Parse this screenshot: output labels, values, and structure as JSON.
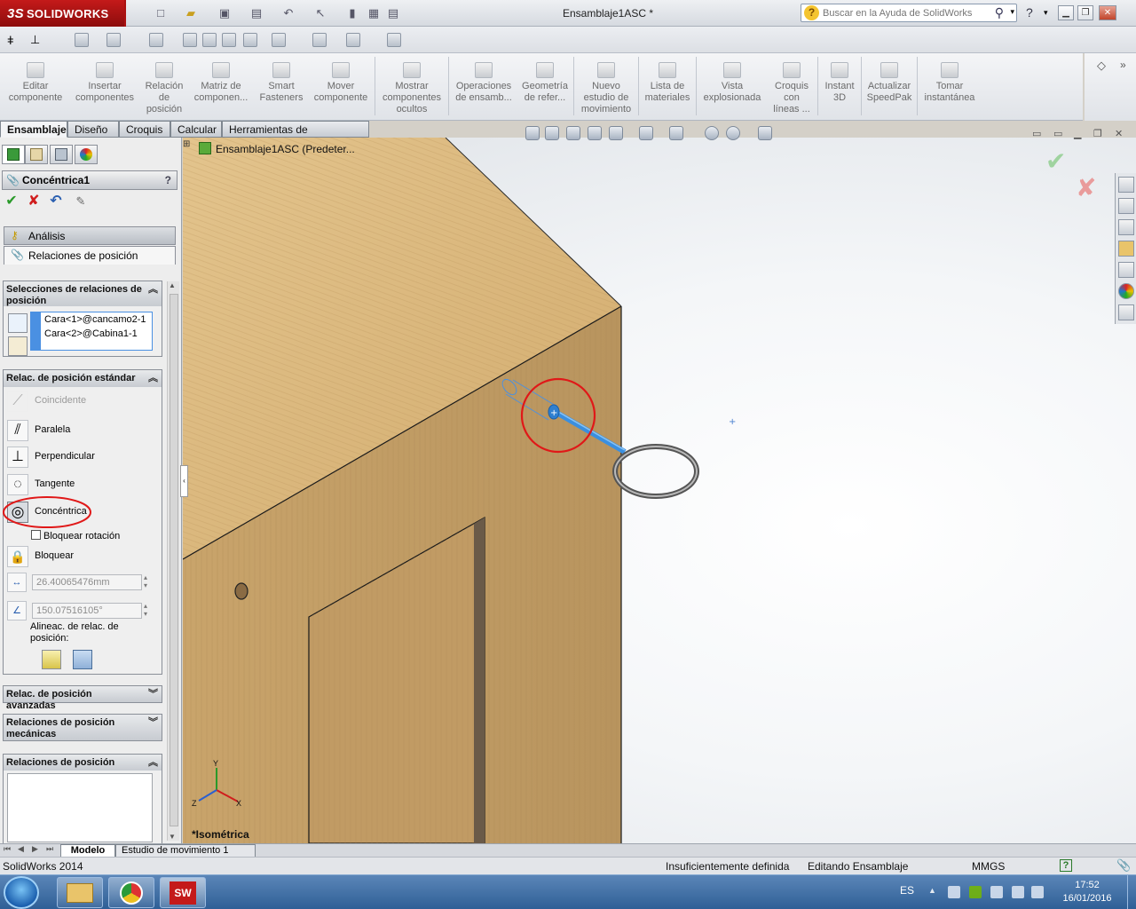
{
  "app": {
    "brand": "SOLIDWORKS",
    "brand_prefix": "3S",
    "window_title": "Ensamblaje1ASC *",
    "help_search_placeholder": "Buscar en la Ayuda de SolidWorks",
    "help_menu": "?"
  },
  "commands": [
    {
      "label": "Editar\ncomponente"
    },
    {
      "label": "Insertar\ncomponentes"
    },
    {
      "label": "Relación\nde\nposición"
    },
    {
      "label": "Matriz de\ncomponen..."
    },
    {
      "label": "Smart\nFasteners"
    },
    {
      "label": "Mover\ncomponente"
    },
    {
      "label": "Mostrar\ncomponentes\nocultos"
    },
    {
      "label": "Operaciones\nde ensamb..."
    },
    {
      "label": "Geometría\nde refer..."
    },
    {
      "label": "Nuevo\nestudio de\nmovimiento"
    },
    {
      "label": "Lista de\nmateriales"
    },
    {
      "label": "Vista\nexplosionada"
    },
    {
      "label": "Croquis\ncon\nlíneas ..."
    },
    {
      "label": "Instant\n3D"
    },
    {
      "label": "Actualizar\nSpeedPak"
    },
    {
      "label": "Tomar\ninstantánea"
    }
  ],
  "tabs": [
    {
      "label": "Ensamblaje"
    },
    {
      "label": "Diseño"
    },
    {
      "label": "Croquis"
    },
    {
      "label": "Calcular"
    },
    {
      "label": "Herramientas de renderizado"
    }
  ],
  "property_manager": {
    "title": "Concéntrica1",
    "help": "?",
    "tab_analysis": "Análisis",
    "tab_mates": "Relaciones de posición",
    "mate_selections": {
      "header": "Selecciones de relaciones de posición",
      "items": [
        "Cara<1>@cancamo2-1",
        "Cara<2>@Cabina1-1"
      ]
    },
    "standard_mates": {
      "header": "Relac. de posición estándar",
      "items": [
        "Coincidente",
        "Paralela",
        "Perpendicular",
        "Tangente",
        "Concéntrica"
      ],
      "lock_rotation": "Bloquear rotación",
      "lock": "Bloquear",
      "distance_value": "26.40065476mm",
      "angle_value": "150.07516105°",
      "alignment_label": "Alineac. de relac. de posición:"
    },
    "advanced_mates_header": "Relac. de posición avanzadas",
    "mechanical_mates_header": "Relaciones de posición mecánicas",
    "mates_list_header": "Relaciones de posición"
  },
  "graphics": {
    "tree_root": "Ensamblaje1ASC  (Predeter...",
    "view_label": "*Isométrica",
    "colors": {
      "wood_top": "#d9b57a",
      "wood_side": "#c19a64",
      "selection_blue": "#3a8fe0",
      "highlight_red": "#e01818"
    }
  },
  "bottom_tabs": [
    {
      "label": "Modelo"
    },
    {
      "label": "Estudio de movimiento 1"
    }
  ],
  "status": {
    "app_version": "SolidWorks 2014",
    "definition": "Insuficientemente definida",
    "mode": "Editando Ensamblaje",
    "units": "MMGS",
    "help": "?"
  },
  "taskbar": {
    "lang": "ES",
    "time": "17:52",
    "date": "16/01/2016",
    "sw_app_label": "SW"
  }
}
